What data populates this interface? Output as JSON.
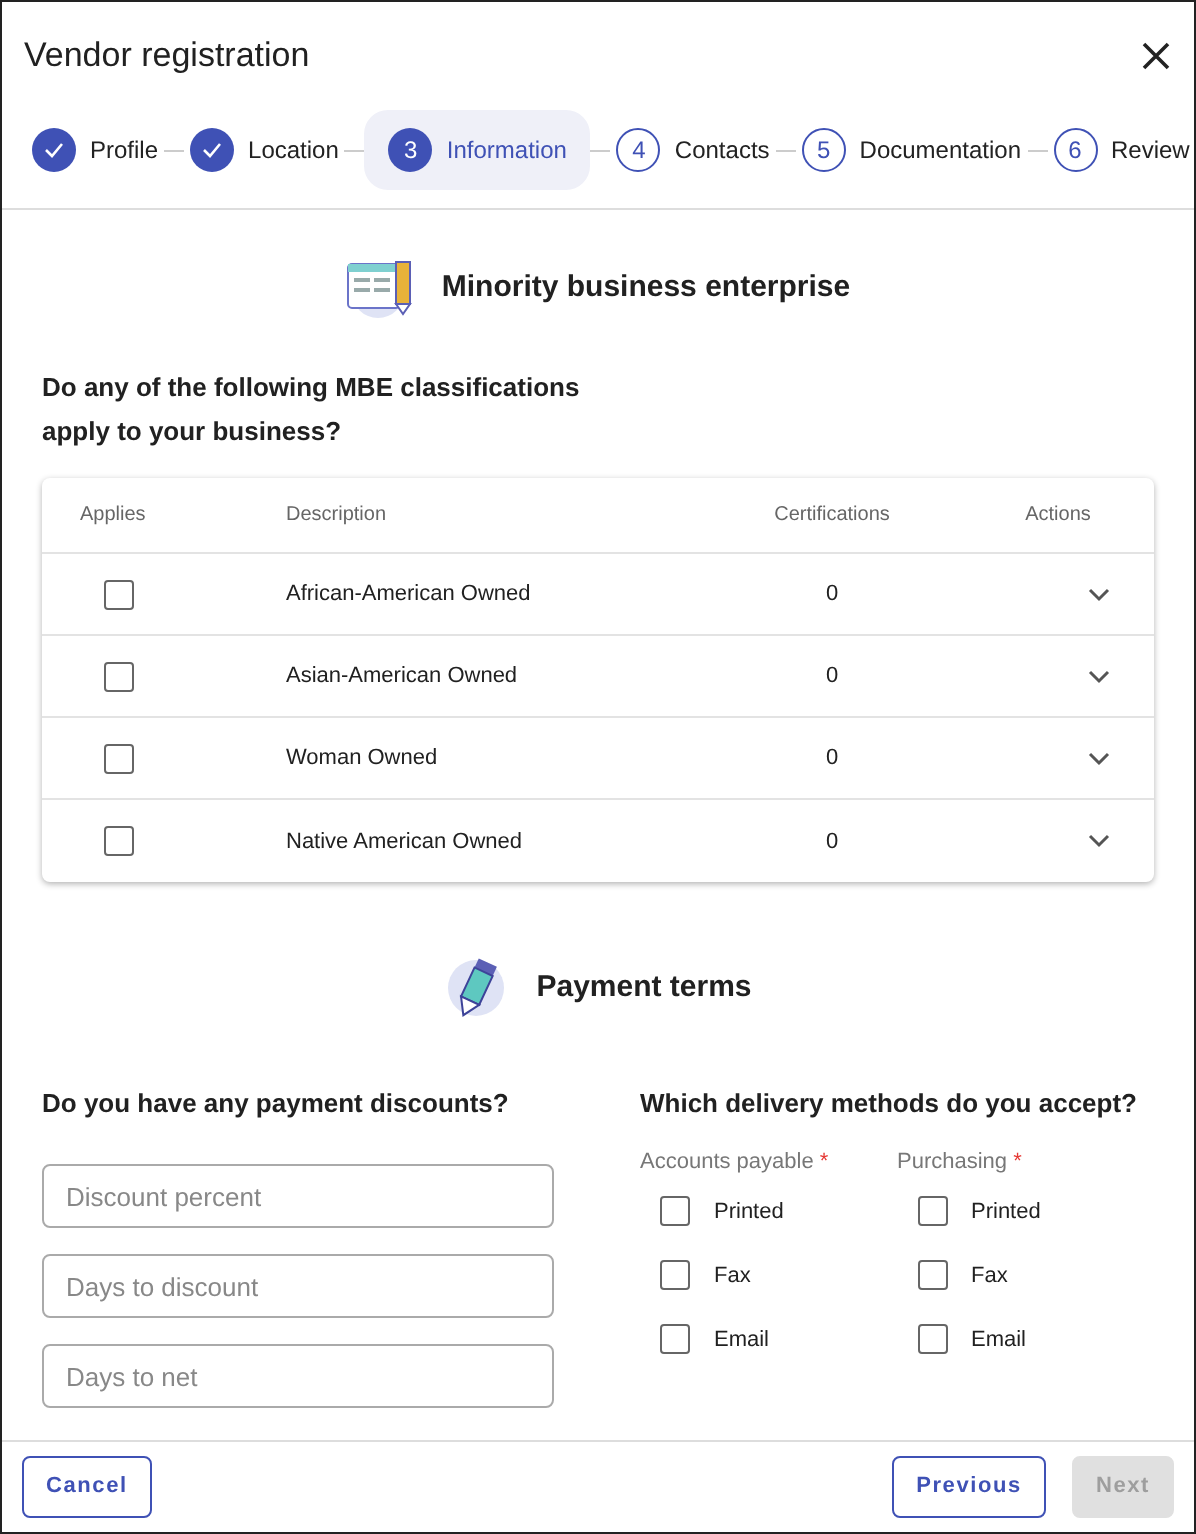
{
  "window": {
    "title": "Vendor registration"
  },
  "steps": [
    {
      "label": "Profile",
      "completed": true,
      "selected": false
    },
    {
      "label": "Location",
      "completed": true,
      "selected": false
    },
    {
      "number": "3",
      "label": "Information",
      "completed": false,
      "selected": true
    },
    {
      "number": "4",
      "label": "Contacts",
      "completed": false,
      "selected": false
    },
    {
      "number": "5",
      "label": "Documentation",
      "completed": false,
      "selected": false
    },
    {
      "number": "6",
      "label": "Review",
      "completed": false,
      "selected": false
    }
  ],
  "mbe": {
    "heading": "Minority business enterprise",
    "question": "Do any of the following MBE classifications apply to your business?",
    "table": {
      "columns": [
        "Applies",
        "Description",
        "Certifications",
        "Actions"
      ],
      "rows": [
        {
          "checked": false,
          "description": "African-American Owned",
          "certifications": "0"
        },
        {
          "checked": false,
          "description": "Asian-American Owned",
          "certifications": "0"
        },
        {
          "checked": false,
          "description": "Woman Owned",
          "certifications": "0"
        },
        {
          "checked": false,
          "description": "Native American Owned",
          "certifications": "0"
        }
      ]
    }
  },
  "payment": {
    "heading": "Payment terms",
    "discount_question": "Do you have any payment discounts?",
    "fields": [
      {
        "placeholder": "Discount percent"
      },
      {
        "placeholder": "Days to discount"
      },
      {
        "placeholder": "Days to net"
      }
    ],
    "delivery_question": "Which delivery methods do you accept?",
    "groups": [
      {
        "label": "Accounts payable",
        "required_mark": "*",
        "options": [
          {
            "label": "Printed",
            "checked": false
          },
          {
            "label": "Fax",
            "checked": false
          },
          {
            "label": "Email",
            "checked": false
          }
        ]
      },
      {
        "label": "Purchasing",
        "required_mark": "*",
        "options": [
          {
            "label": "Printed",
            "checked": false
          },
          {
            "label": "Fax",
            "checked": false
          },
          {
            "label": "Email",
            "checked": false
          }
        ]
      }
    ]
  },
  "footer": {
    "buttons": [
      {
        "label": "Cancel",
        "disabled": false
      },
      {
        "label": "Previous",
        "disabled": false
      },
      {
        "label": "Next",
        "disabled": true
      }
    ]
  }
}
